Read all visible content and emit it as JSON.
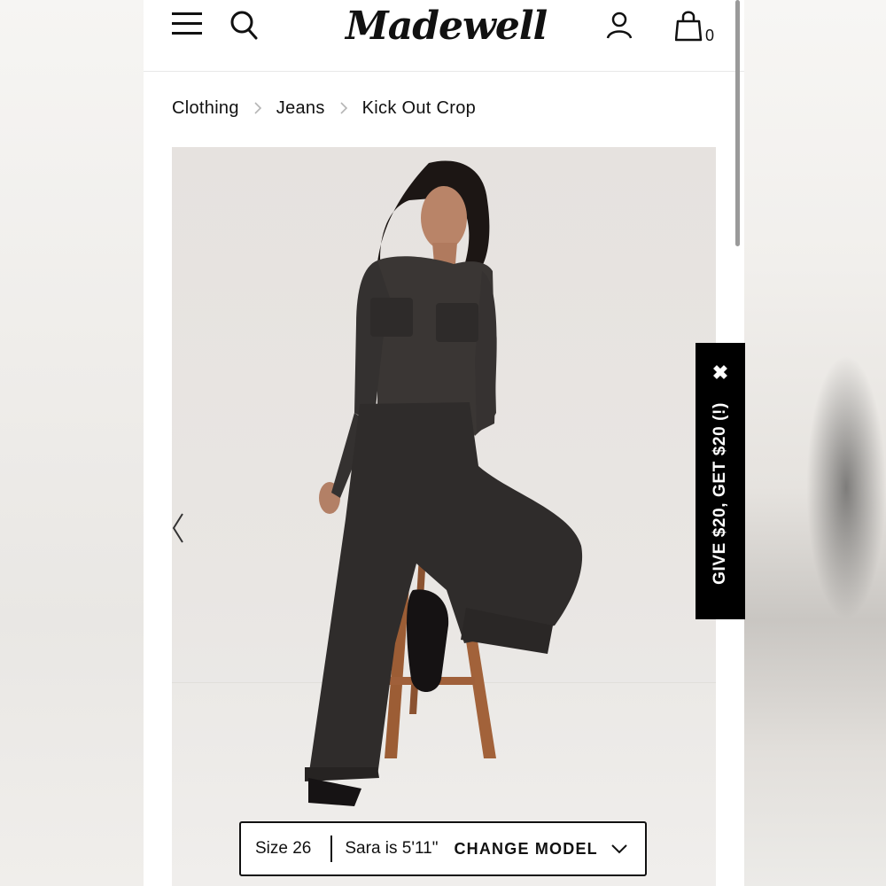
{
  "header": {
    "brand": "Madewell",
    "bag_count": "0"
  },
  "breadcrumb": {
    "items": [
      "Clothing",
      "Jeans",
      "Kick Out Crop"
    ]
  },
  "promo": {
    "close_glyph": "✖",
    "label": "GIVE $20, GET $20 (!)"
  },
  "model_bar": {
    "size": "Size 26",
    "model": "Sara is 5'11\"",
    "change": "CHANGE MODEL"
  },
  "colors": {
    "accent": "#000000",
    "background": "#ffffff",
    "denim": "#2f2c2b",
    "stool": "#a2623a"
  },
  "icons": [
    "menu-icon",
    "search-icon",
    "account-icon",
    "bag-icon",
    "chevron-right-icon",
    "chevron-left-icon",
    "close-icon",
    "chevron-down-icon"
  ]
}
